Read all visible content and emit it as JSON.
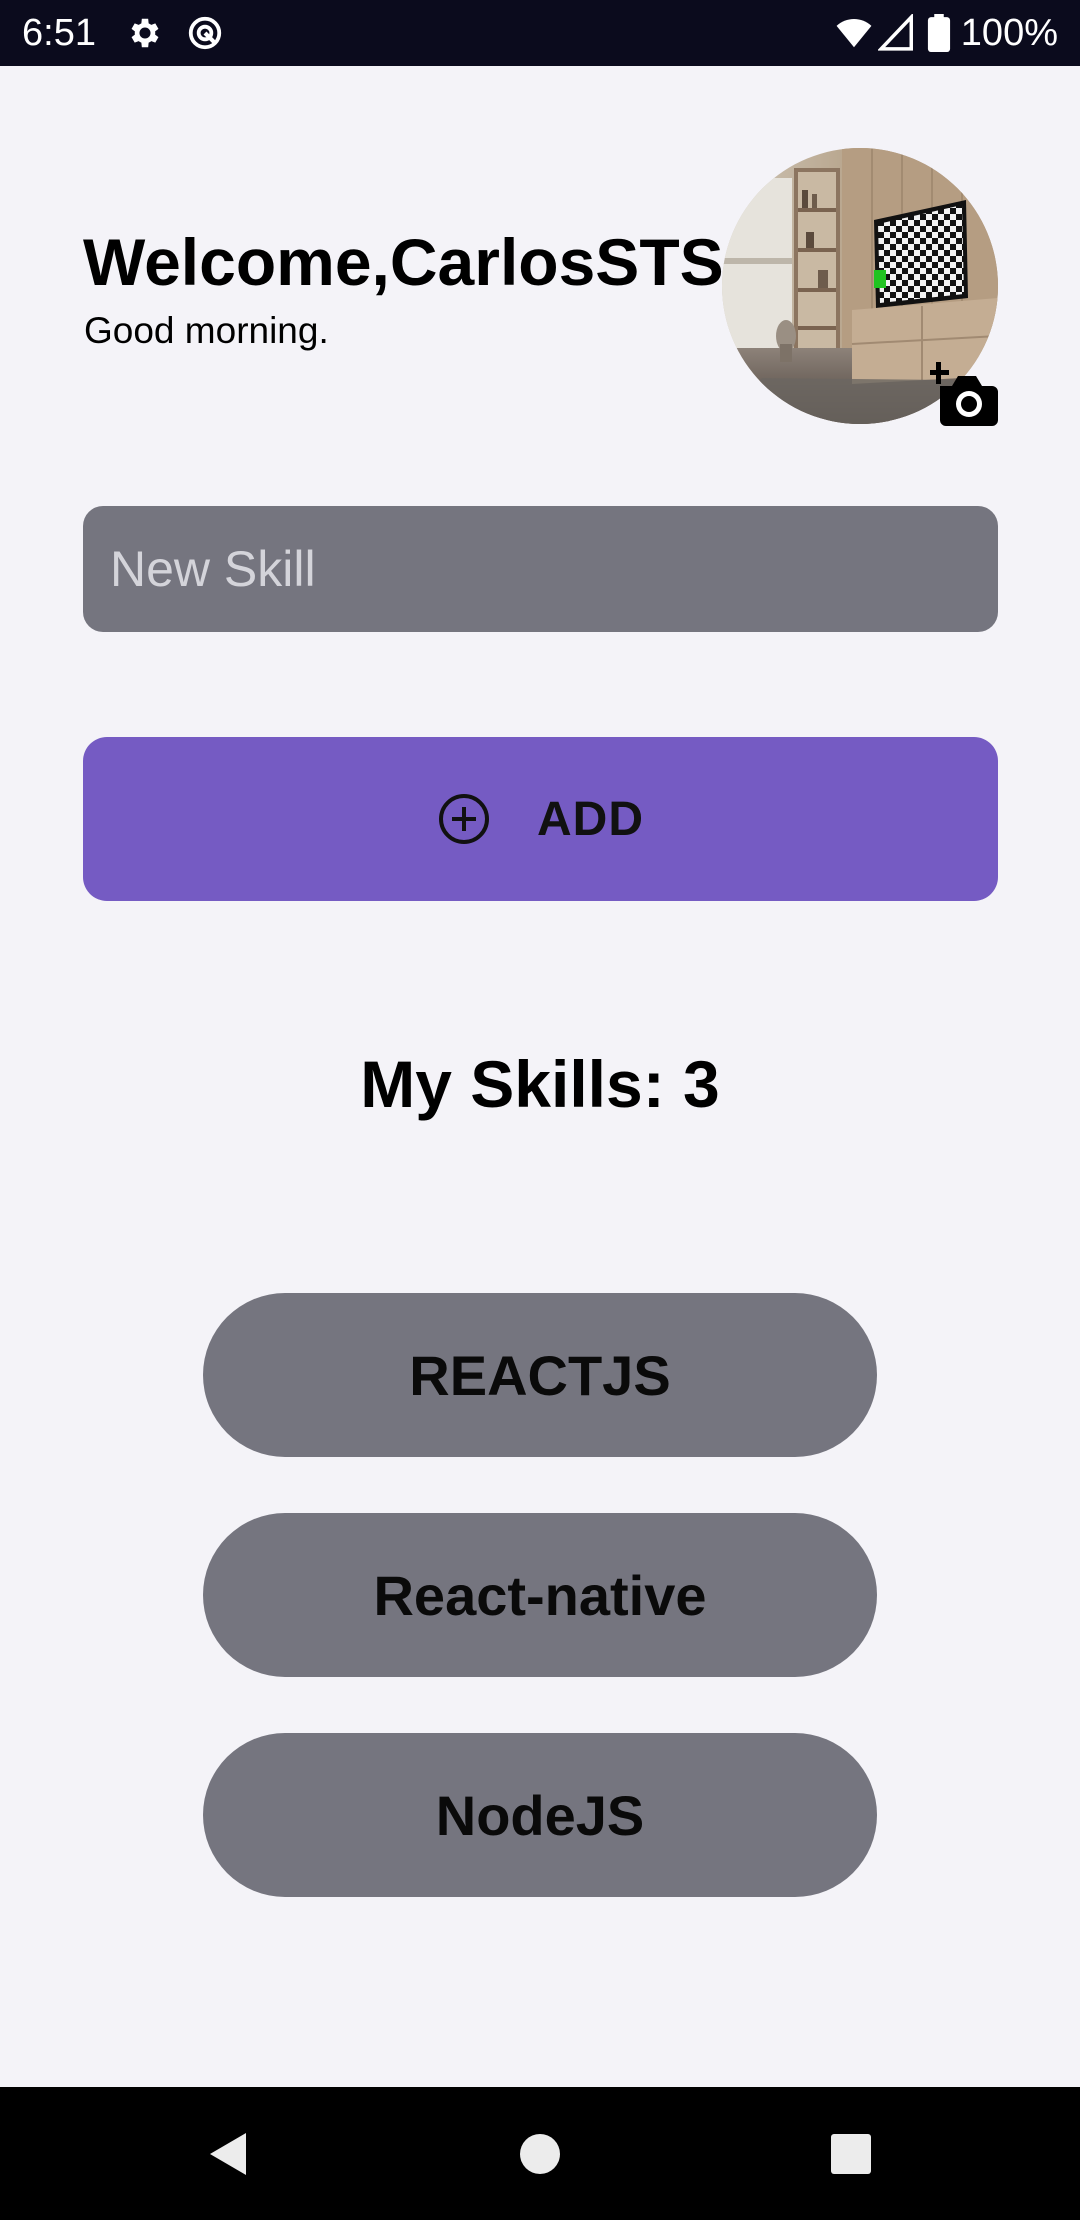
{
  "status_bar": {
    "time": "6:51",
    "icons": [
      "settings-icon",
      "vpn-icon",
      "wifi-icon",
      "cell-signal-icon",
      "battery-icon"
    ],
    "battery_text": "100%"
  },
  "header": {
    "title": "Welcome,CarlosSTS",
    "subtitle": "Good morning.",
    "avatar_icon": "room-photo-avatar",
    "camera_icon": "add-photo-icon"
  },
  "skill_input": {
    "value": "",
    "placeholder": "New Skill"
  },
  "add_button": {
    "label": "ADD",
    "icon": "plus-circle-icon"
  },
  "skills": {
    "heading": "My Skills: 3",
    "items": [
      {
        "label": "REACTJS"
      },
      {
        "label": "React-native"
      },
      {
        "label": "NodeJS"
      }
    ]
  },
  "nav_bar": {
    "icons": [
      "back-icon",
      "home-icon",
      "recents-icon"
    ]
  },
  "colors": {
    "background": "#f4f3f8",
    "status_bar": "#0b0b1d",
    "input_background": "#75757f",
    "accent": "#755bc3",
    "skill_card": "#75757f",
    "nav_bar": "#000000"
  }
}
